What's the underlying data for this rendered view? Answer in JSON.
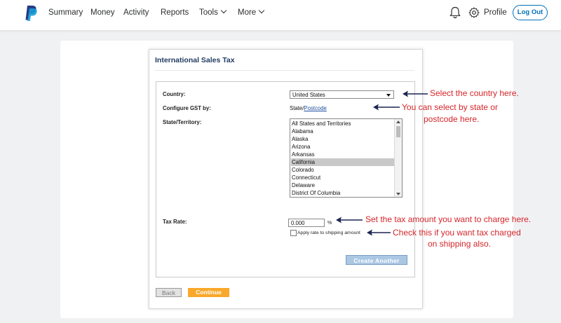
{
  "nav": {
    "items": [
      "Summary",
      "Money",
      "Activity",
      "Reports",
      "Tools",
      "More"
    ],
    "profile": "Profile",
    "logout": "Log Out"
  },
  "panel": {
    "title": "International Sales Tax",
    "country_label": "Country:",
    "country_value": "United States",
    "configure_label": "Configure GST by:",
    "configure_state": "State/",
    "configure_postcode": "Postcode",
    "state_label": "State/Territory:",
    "states": [
      "All States and Territories",
      "Alabama",
      "Alaska",
      "Arizona",
      "Arkansas",
      "California",
      "Colorado",
      "Connecticut",
      "Delaware",
      "District Of Columbia"
    ],
    "selected_state": "California",
    "tax_label": "Tax Rate:",
    "tax_value": "0.000",
    "percent": "%",
    "shipping_label": "Apply rate to shipping amount",
    "create_another": "Create Another",
    "back": "Back",
    "continue": "Continue"
  },
  "annotations": {
    "country": "Select the country here.",
    "state_line1": "You can select by state or",
    "state_line2": "postcode here.",
    "tax": "Set the tax amount you want to charge here.",
    "shipping_line1": "Check this if you want tax charged",
    "shipping_line2": "on shipping also."
  },
  "colors": {
    "brand_blue": "#0070ba",
    "annotation_red": "#d5262a",
    "continue_orange": "#f9a82a"
  }
}
